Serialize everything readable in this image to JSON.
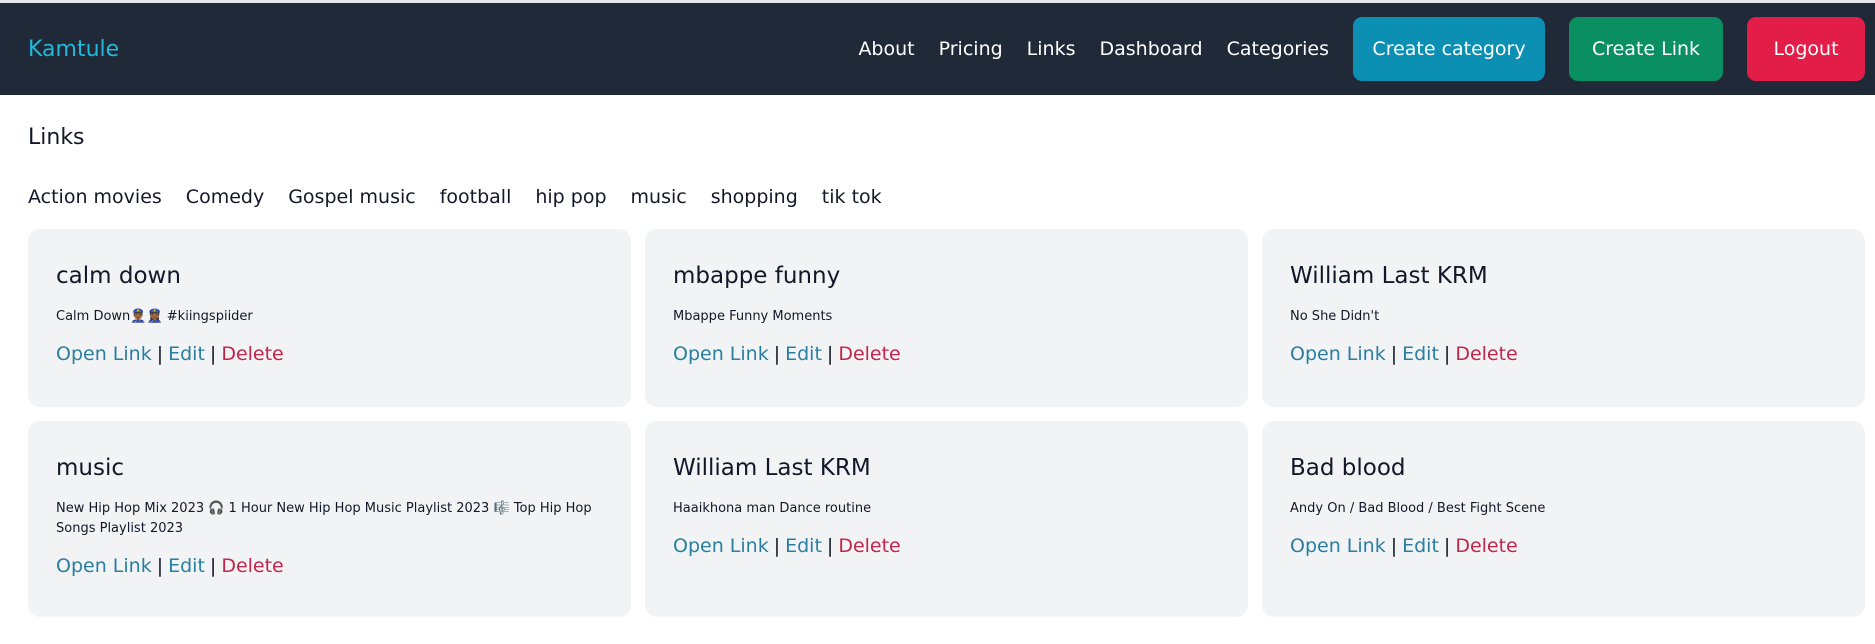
{
  "app": {
    "brand": "Kamtule"
  },
  "nav": {
    "links": [
      "About",
      "Pricing",
      "Links",
      "Dashboard",
      "Categories"
    ],
    "create_category": "Create category",
    "create_link": "Create Link",
    "logout": "Logout"
  },
  "page": {
    "title": "Links"
  },
  "categories": [
    "Action movies",
    "Comedy",
    "Gospel music",
    "football",
    "hip pop",
    "music",
    "shopping",
    "tik tok"
  ],
  "actions": {
    "open": "Open Link",
    "edit": "Edit",
    "delete": "Delete",
    "separator": "|"
  },
  "cards": [
    {
      "title": "calm down",
      "description": "Calm Down👮🏾‍♂️👮🏾‍♀️ #kiingspiider"
    },
    {
      "title": "mbappe funny",
      "description": "Mbappe Funny Moments"
    },
    {
      "title": "William Last KRM",
      "description": "No She Didn't"
    },
    {
      "title": "music",
      "description": "New Hip Hop Mix 2023 🎧 1 Hour New Hip Hop Music Playlist 2023 🎼 Top Hip Hop Songs Playlist 2023"
    },
    {
      "title": "William Last KRM",
      "description": "Haaikhona man Dance routine"
    },
    {
      "title": "Bad blood",
      "description": "Andy On / Bad Blood / Best Fight Scene"
    }
  ],
  "colors": {
    "navbar": "#1f2937",
    "brand": "#22b8d9",
    "create_category": "#0b8fb3",
    "create_link": "#0a8f62",
    "logout": "#e11d48",
    "link": "#2a7fa0",
    "delete": "#c2264a",
    "card_bg": "#f2f3f5"
  }
}
